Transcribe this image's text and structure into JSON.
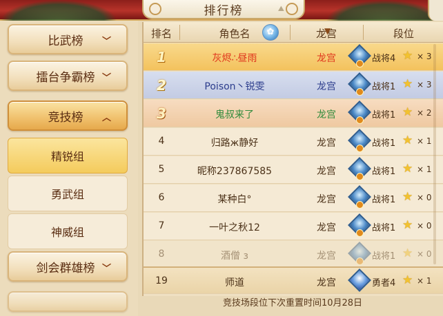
{
  "window": {
    "title": "排行榜"
  },
  "sidebar": {
    "items": [
      {
        "label": "比武榜",
        "expanded": false
      },
      {
        "label": "擂台争霸榜",
        "expanded": false
      },
      {
        "label": "竞技榜",
        "expanded": true
      },
      {
        "label": "剑会群雄榜",
        "expanded": false
      }
    ],
    "subitems": [
      {
        "label": "精锐组",
        "selected": true
      },
      {
        "label": "勇武组",
        "selected": false
      },
      {
        "label": "神威组",
        "selected": false
      }
    ]
  },
  "table": {
    "headers": {
      "rank": "排名",
      "name": "角色名",
      "faction": "龙宫",
      "grade": "段位"
    },
    "rows": [
      {
        "rank": "1",
        "name": "灰烬∴昼雨",
        "faction": "龙宫",
        "grade": "战将4",
        "stars": "× 3",
        "style": "r1"
      },
      {
        "rank": "2",
        "name": "Poison丶锐雯",
        "faction": "龙宫",
        "grade": "战将1",
        "stars": "× 3",
        "style": "r2"
      },
      {
        "rank": "3",
        "name": "鬼叔来了",
        "faction": "龙宫",
        "grade": "战将1",
        "stars": "× 2",
        "style": "r3"
      },
      {
        "rank": "4",
        "name": "归路ж静好",
        "faction": "龙宫",
        "grade": "战将1",
        "stars": "× 1",
        "style": ""
      },
      {
        "rank": "5",
        "name": "昵称237867585",
        "faction": "龙宫",
        "grade": "战将1",
        "stars": "× 1",
        "style": ""
      },
      {
        "rank": "6",
        "name": "某种白°",
        "faction": "龙宫",
        "grade": "战将1",
        "stars": "× 0",
        "style": ""
      },
      {
        "rank": "7",
        "name": "一叶之秋12",
        "faction": "龙宫",
        "grade": "战将1",
        "stars": "× 0",
        "style": ""
      },
      {
        "rank": "8",
        "name": "酒僧 з",
        "faction": "龙宫",
        "grade": "战将1",
        "stars": "× 0",
        "style": "faded"
      }
    ],
    "my_row": {
      "rank": "19",
      "name": "师道",
      "faction": "龙宫",
      "grade": "勇者4",
      "stars": "× 1"
    }
  },
  "footer": {
    "text": "竞技场段位下次重置时间10月28日"
  },
  "colors": {
    "accent_red": "#e0361c",
    "gold": "#f3c25d",
    "bg": "#efe0c2"
  }
}
